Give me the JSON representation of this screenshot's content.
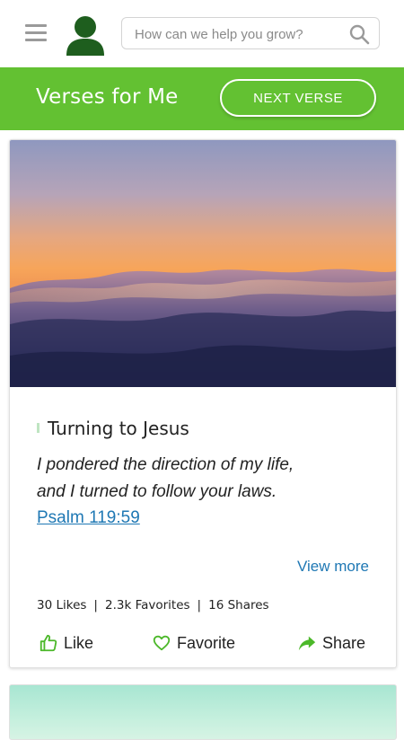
{
  "header": {
    "search_placeholder": "How can we help you grow?",
    "menu_icon": "hamburger-menu-icon",
    "avatar_icon": "user-avatar-icon",
    "search_icon": "search-icon"
  },
  "banner": {
    "title": "Verses for Me",
    "next_button": "NEXT VERSE",
    "color": "#63c132"
  },
  "card": {
    "image_icon": "sky-clouds-sunset-image",
    "title": "Turning to Jesus",
    "verse_lines": [
      "I pondered the direction of my life,",
      "and I turned to follow your laws."
    ],
    "reference": "Psalm 119:59",
    "view_more": "View more",
    "stats": {
      "likes": "30 Likes",
      "favorites": "2.3k Favorites",
      "shares": "16 Shares",
      "separator": "|"
    },
    "actions": {
      "like": "Like",
      "favorite": "Favorite",
      "share": "Share"
    },
    "action_color": "#4cb82a",
    "link_color": "#1f78b4"
  },
  "next_card": {
    "image_icon": "sky-image"
  }
}
